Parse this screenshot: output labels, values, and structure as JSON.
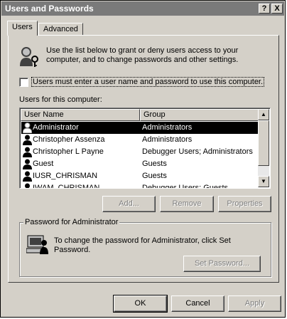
{
  "window": {
    "title": "Users and Passwords",
    "help_label": "?",
    "close_label": "X"
  },
  "tabs": [
    {
      "label": "Users"
    },
    {
      "label": "Advanced"
    }
  ],
  "intro": {
    "text": "Use the list below to grant or deny users access to your computer, and to change passwords and other settings."
  },
  "require_login": {
    "label": "Users must enter a user name and password to use this computer.",
    "checked": false
  },
  "users_list": {
    "label": "Users for this computer:",
    "columns": [
      "User Name",
      "Group"
    ],
    "rows": [
      {
        "name": "Administrator",
        "group": "Administrators",
        "selected": true
      },
      {
        "name": "Christopher Assenza",
        "group": "Administrators",
        "selected": false
      },
      {
        "name": "Christopher L Payne",
        "group": "Debugger Users; Administrators",
        "selected": false
      },
      {
        "name": "Guest",
        "group": "Guests",
        "selected": false
      },
      {
        "name": "IUSR_CHRISMAN",
        "group": "Guests",
        "selected": false
      },
      {
        "name": "IWAM_CHRISMAN",
        "group": "Debugger Users; Guests",
        "selected": false
      }
    ]
  },
  "list_buttons": {
    "add": "Add...",
    "remove": "Remove",
    "properties": "Properties"
  },
  "password_group": {
    "title": "Password for Administrator",
    "text": "To change the password for Administrator, click Set Password.",
    "set_password": "Set Password..."
  },
  "dialog_buttons": {
    "ok": "OK",
    "cancel": "Cancel",
    "apply": "Apply"
  },
  "colors": {
    "face": "#d4d0c8",
    "titlebar": "#7a7a7a",
    "selection": "#000000"
  }
}
